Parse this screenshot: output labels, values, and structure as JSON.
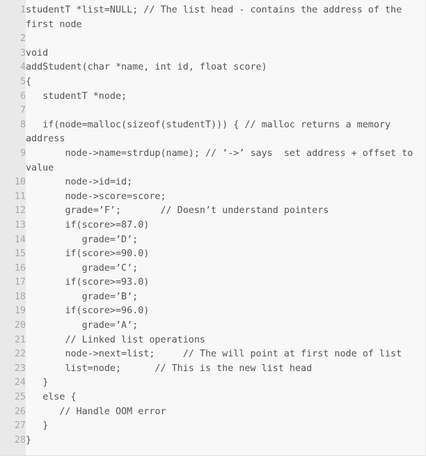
{
  "widget": {
    "name": "code-listing",
    "language": "c",
    "colors": {
      "gutter_bg": "#e9e9e9",
      "code_bg": "#f8f8f8",
      "code_text": "#555555",
      "line_number_text": "#a9a9a9",
      "border": "#e2e2e2"
    },
    "first_line_number": 1,
    "last_line_number": 28,
    "total_lines": 28
  },
  "lines": [
    {
      "number": "1",
      "text": "studentT *list=NULL; // The list head - contains the address of the first node"
    },
    {
      "number": "2",
      "text": ""
    },
    {
      "number": "3",
      "text": "void"
    },
    {
      "number": "4",
      "text": "addStudent(char *name, int id, float score)"
    },
    {
      "number": "5",
      "text": "{"
    },
    {
      "number": "6",
      "text": "   studentT *node;"
    },
    {
      "number": "7",
      "text": ""
    },
    {
      "number": "8",
      "text": "   if(node=malloc(sizeof(studentT))) { // malloc returns a memory address"
    },
    {
      "number": "9",
      "text": "       node->name=strdup(name); // ’->’ says  set address + offset to value"
    },
    {
      "number": "10",
      "text": "       node->id=id;"
    },
    {
      "number": "11",
      "text": "       node->score=score;"
    },
    {
      "number": "12",
      "text": "       grade=’F’;       // Doesn’t understand pointers"
    },
    {
      "number": "13",
      "text": "       if(score>=87.0)"
    },
    {
      "number": "14",
      "text": "          grade=’D’;"
    },
    {
      "number": "15",
      "text": "       if(score>=90.0)"
    },
    {
      "number": "16",
      "text": "          grade=’C’;"
    },
    {
      "number": "17",
      "text": "       if(score>=93.0)"
    },
    {
      "number": "18",
      "text": "          grade=’B’;"
    },
    {
      "number": "19",
      "text": "       if(score>=96.0)"
    },
    {
      "number": "20",
      "text": "          grade=’A’;"
    },
    {
      "number": "21",
      "text": "       // Linked list operations"
    },
    {
      "number": "22",
      "text": "       node->next=list;     // The will point at first node of list"
    },
    {
      "number": "23",
      "text": "       list=node;      // This is the new list head"
    },
    {
      "number": "24",
      "text": "   }"
    },
    {
      "number": "25",
      "text": "   else {"
    },
    {
      "number": "26",
      "text": "      // Handle OOM error"
    },
    {
      "number": "27",
      "text": "   }"
    },
    {
      "number": "28",
      "text": "}"
    }
  ]
}
